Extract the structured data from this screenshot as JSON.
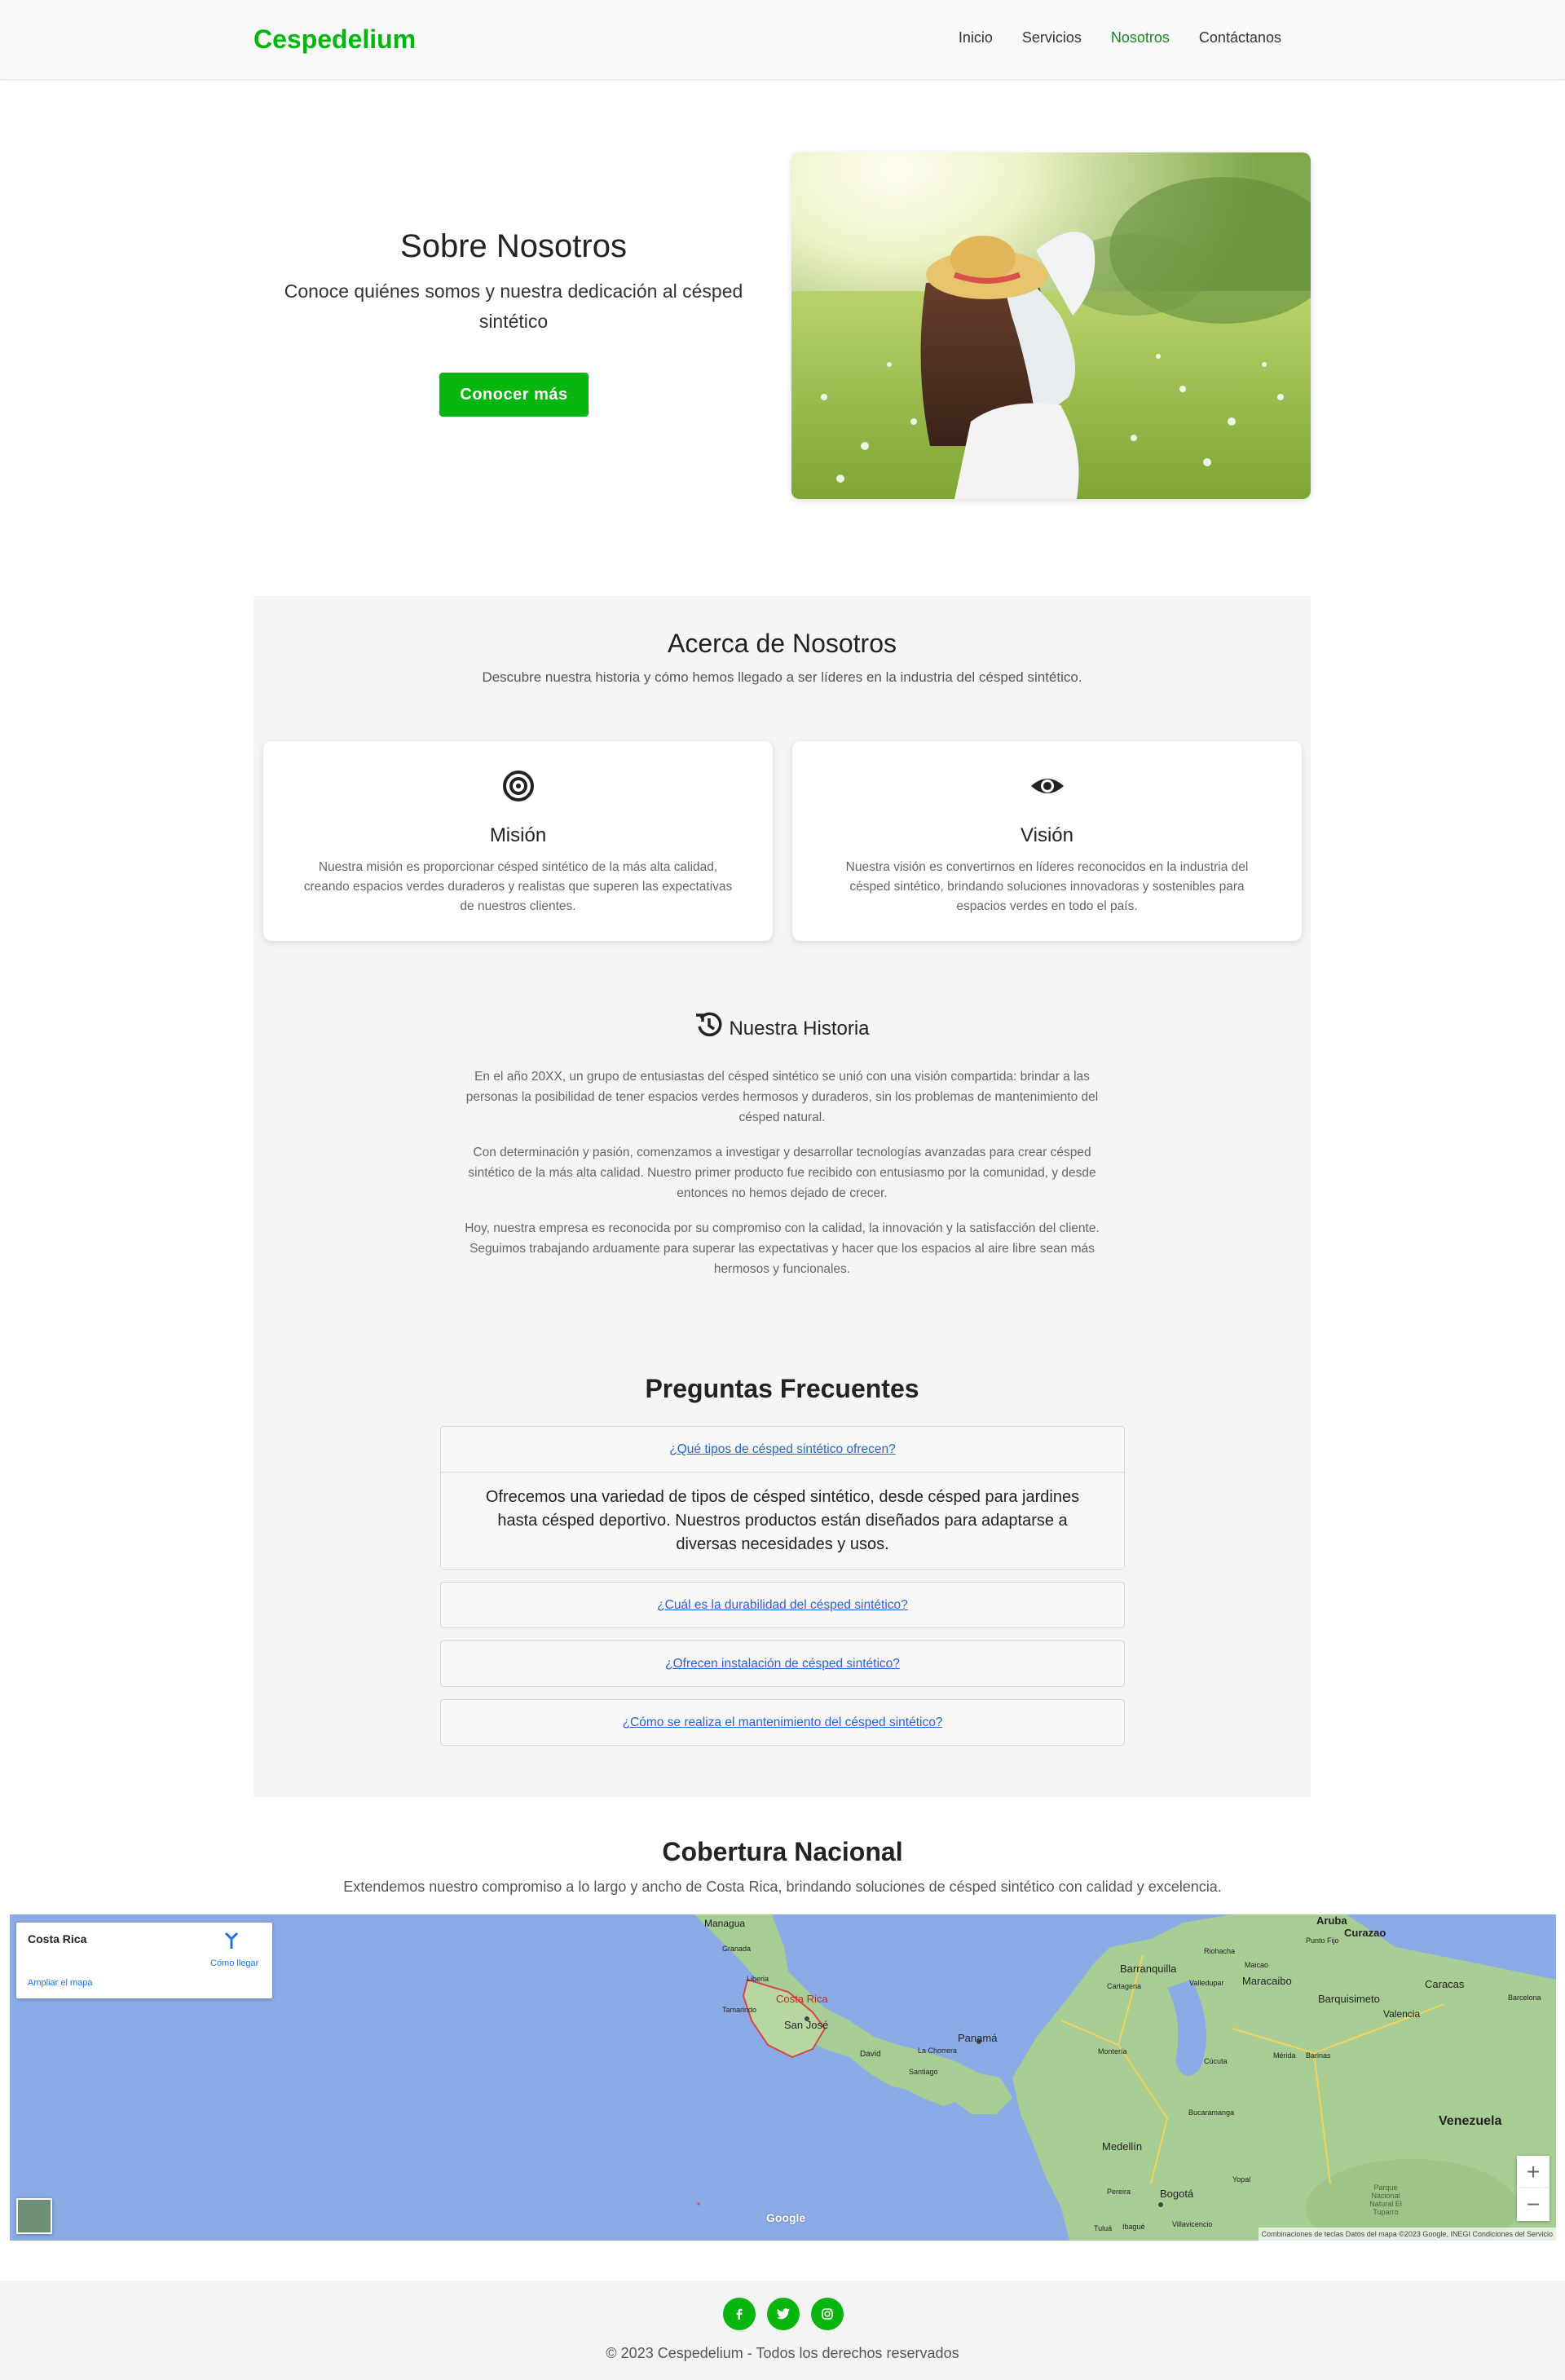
{
  "nav": {
    "brand": "Cespedelium",
    "links": [
      "Inicio",
      "Servicios",
      "Nosotros",
      "Contáctanos"
    ],
    "active": "Nosotros"
  },
  "hero": {
    "title": "Sobre Nosotros",
    "subtitle": "Conoce quiénes somos y nuestra dedicación al césped sintético",
    "button": "Conocer más"
  },
  "about": {
    "title": "Acerca de Nosotros",
    "subtitle": "Descubre nuestra historia y cómo hemos llegado a ser líderes en la industria del césped sintético.",
    "cards": [
      {
        "icon": "target-icon",
        "title": "Misión",
        "text": "Nuestra misión es proporcionar césped sintético de la más alta calidad, creando espacios verdes duraderos y realistas que superen las expectativas de nuestros clientes."
      },
      {
        "icon": "eye-icon",
        "title": "Visión",
        "text": "Nuestra visión es convertirnos en líderes reconocidos en la industria del césped sintético, brindando soluciones innovadoras y sostenibles para espacios verdes en todo el país."
      }
    ]
  },
  "history": {
    "title": "Nuestra Historia",
    "paragraphs": [
      "En el año 20XX, un grupo de entusiastas del césped sintético se unió con una visión compartida: brindar a las personas la posibilidad de tener espacios verdes hermosos y duraderos, sin los problemas de mantenimiento del césped natural.",
      "Con determinación y pasión, comenzamos a investigar y desarrollar tecnologías avanzadas para crear césped sintético de la más alta calidad. Nuestro primer producto fue recibido con entusiasmo por la comunidad, y desde entonces no hemos dejado de crecer.",
      "Hoy, nuestra empresa es reconocida por su compromiso con la calidad, la innovación y la satisfacción del cliente. Seguimos trabajando arduamente para superar las expectativas y hacer que los espacios al aire libre sean más hermosos y funcionales."
    ]
  },
  "faq": {
    "title": "Preguntas Frecuentes",
    "items": [
      {
        "q": "¿Qué tipos de césped sintético ofrecen?",
        "a": "Ofrecemos una variedad de tipos de césped sintético, desde césped para jardines hasta césped deportivo. Nuestros productos están diseñados para adaptarse a diversas necesidades y usos."
      },
      {
        "q": "¿Cuál es la durabilidad del césped sintético?"
      },
      {
        "q": "¿Ofrecen instalación de césped sintético?"
      },
      {
        "q": "¿Cómo se realiza el mantenimiento del césped sintético?"
      }
    ]
  },
  "coverage": {
    "title": "Cobertura Nacional",
    "subtitle": "Extendemos nuestro compromiso a lo largo y ancho de Costa Rica, brindando soluciones de césped sintético con calidad y excelencia.",
    "map": {
      "place": "Costa Rica",
      "directions": "Cómo llegar",
      "enlarge": "Ampliar el mapa",
      "zoom_in": "+",
      "zoom_out": "−",
      "google": "Google",
      "attribution": "Combinaciones de teclas   Datos del mapa ©2023 Google, INEGI   Condiciones del Servicio",
      "labels": [
        "Managua",
        "Granada",
        "Liberia",
        "Costa Rica",
        "Tamarindo",
        "San José",
        "David",
        "Panamá",
        "La Chorrera",
        "Santiago",
        "Aruba",
        "Curazao",
        "Punto Fijo",
        "Riohacha",
        "Maicao",
        "Barranquilla",
        "Cartagena",
        "Valledupar",
        "Maracaibo",
        "Caracas",
        "Barquisimeto",
        "Valencia",
        "Barcelona",
        "Montería",
        "Mérida",
        "Barinas",
        "Cúcuta",
        "Bucaramanga",
        "Venezuela",
        "Medellín",
        "Yopal",
        "Pereira",
        "Bogotá",
        "Villavicencio",
        "Ibagué",
        "Tuluá",
        "Parque Nacional Natural El Tuparro"
      ]
    }
  },
  "footer": {
    "socials": [
      "facebook-icon",
      "twitter-icon",
      "instagram-icon"
    ],
    "copyright": "© 2023 Cespedelium - Todos los derechos reservados"
  }
}
